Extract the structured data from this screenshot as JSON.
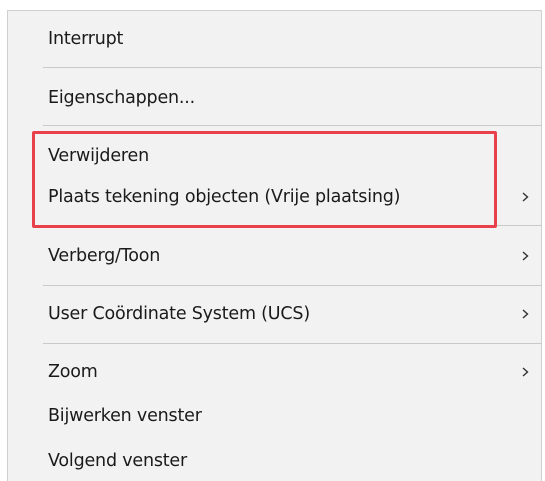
{
  "menu": {
    "items": [
      {
        "label": "Interrupt",
        "submenu": false
      },
      {
        "label": "Eigenschappen...",
        "submenu": false
      },
      {
        "label": "Verwijderen",
        "submenu": false
      },
      {
        "label": "Plaats tekening objecten (Vrije plaatsing)",
        "submenu": true
      },
      {
        "label": "Verberg/Toon",
        "submenu": true
      },
      {
        "label": "User Coördinate System (UCS)",
        "submenu": true
      },
      {
        "label": "Zoom",
        "submenu": true
      },
      {
        "label": "Bijwerken venster",
        "submenu": false
      },
      {
        "label": "Volgend venster",
        "submenu": false
      }
    ],
    "highlight_color": "#e8414b",
    "background_color": "#f2f2f2",
    "submenu_icon": "chevron-right-icon"
  }
}
